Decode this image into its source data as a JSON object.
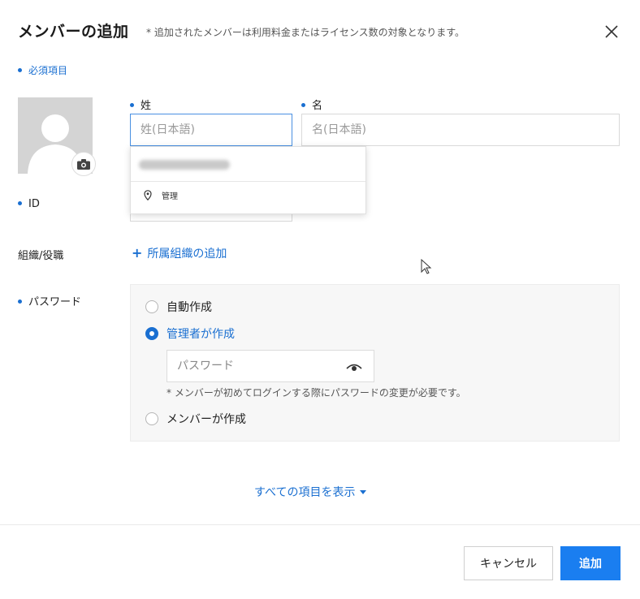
{
  "dialog": {
    "title": "メンバーの追加",
    "note": "* 追加されたメンバーは利用料金またはライセンス数の対象となります。",
    "required_note": "必須項目"
  },
  "fields": {
    "last_name_label": "姓",
    "last_name_placeholder": "姓(日本語)",
    "first_name_label": "名",
    "first_name_placeholder": "名(日本語)",
    "id_label": "ID",
    "org_label": "組織/役職",
    "org_add": "所属組織の追加",
    "password_label": "パスワード"
  },
  "autocomplete": {
    "item_location": "管理"
  },
  "password": {
    "options": [
      {
        "label": "自動作成",
        "selected": false
      },
      {
        "label": "管理者が作成",
        "selected": true
      },
      {
        "label": "メンバーが作成",
        "selected": false
      }
    ],
    "input_placeholder": "パスワード",
    "note": "* メンバーが初めてログインする際にパスワードの変更が必要です。"
  },
  "show_all": "すべての項目を表示",
  "buttons": {
    "cancel": "キャンセル",
    "add": "追加"
  },
  "colors": {
    "accent": "#1a7ef0",
    "link": "#1a6fd1"
  },
  "icons": {
    "close": "close-icon",
    "camera": "camera-icon",
    "eye": "eye-icon",
    "pin": "location-pin-icon",
    "caret": "caret-down-icon"
  }
}
